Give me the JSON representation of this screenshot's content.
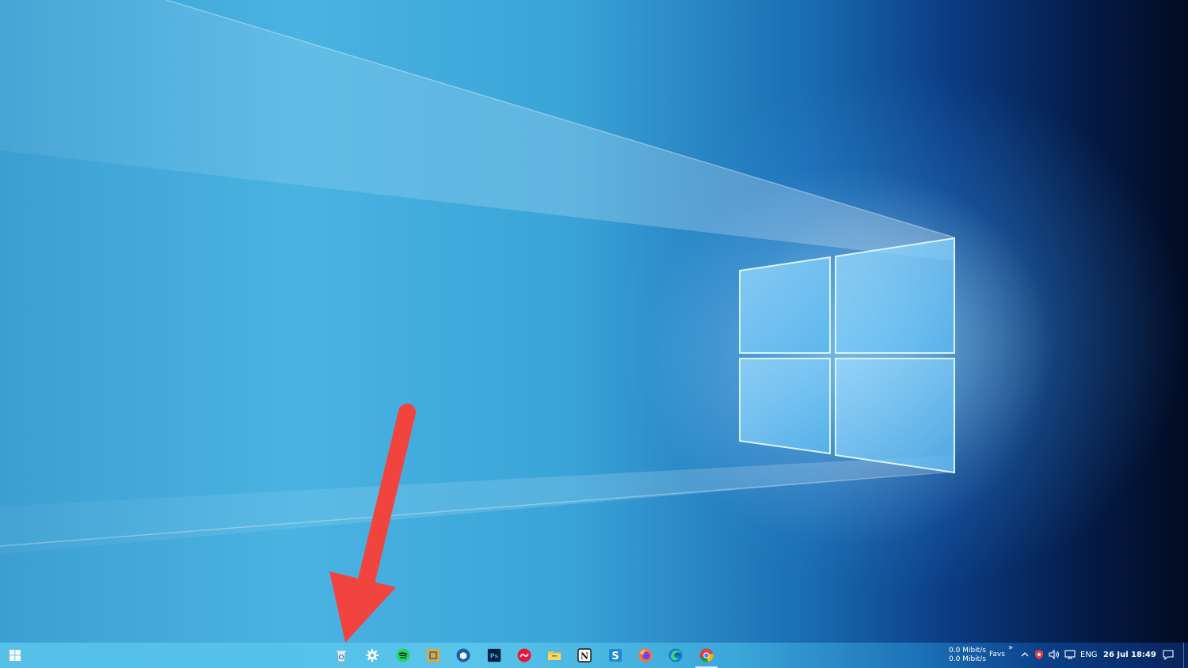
{
  "desktop": {
    "wallpaper": "windows-10-hero-wallpaper",
    "annotation_color": "#f2443f"
  },
  "taskbar": {
    "start_icon": "windows-logo-icon",
    "pinned_apps": [
      {
        "name": "recycle-bin-icon",
        "active": false
      },
      {
        "name": "settings-gear-icon",
        "active": false
      },
      {
        "name": "spotify-icon",
        "active": false
      },
      {
        "name": "orange-app-icon",
        "active": false
      },
      {
        "name": "blue-circle-app-icon",
        "active": false
      },
      {
        "name": "photoshop-icon",
        "active": false
      },
      {
        "name": "creative-cloud-icon",
        "active": false
      },
      {
        "name": "file-explorer-icon",
        "active": false
      },
      {
        "name": "notion-icon",
        "active": false
      },
      {
        "name": "blue-s-app-icon",
        "active": false
      },
      {
        "name": "firefox-icon",
        "active": false
      },
      {
        "name": "edge-icon",
        "active": false
      },
      {
        "name": "chrome-icon",
        "active": true
      }
    ],
    "tray": {
      "upload_speed": "0.0 Mibit/s",
      "download_speed": "0.0 Mibit/s",
      "favs_label": "Favs",
      "favs_chevron": "»",
      "language": "ENG",
      "date": "26 Jul",
      "time": "18:49"
    }
  }
}
